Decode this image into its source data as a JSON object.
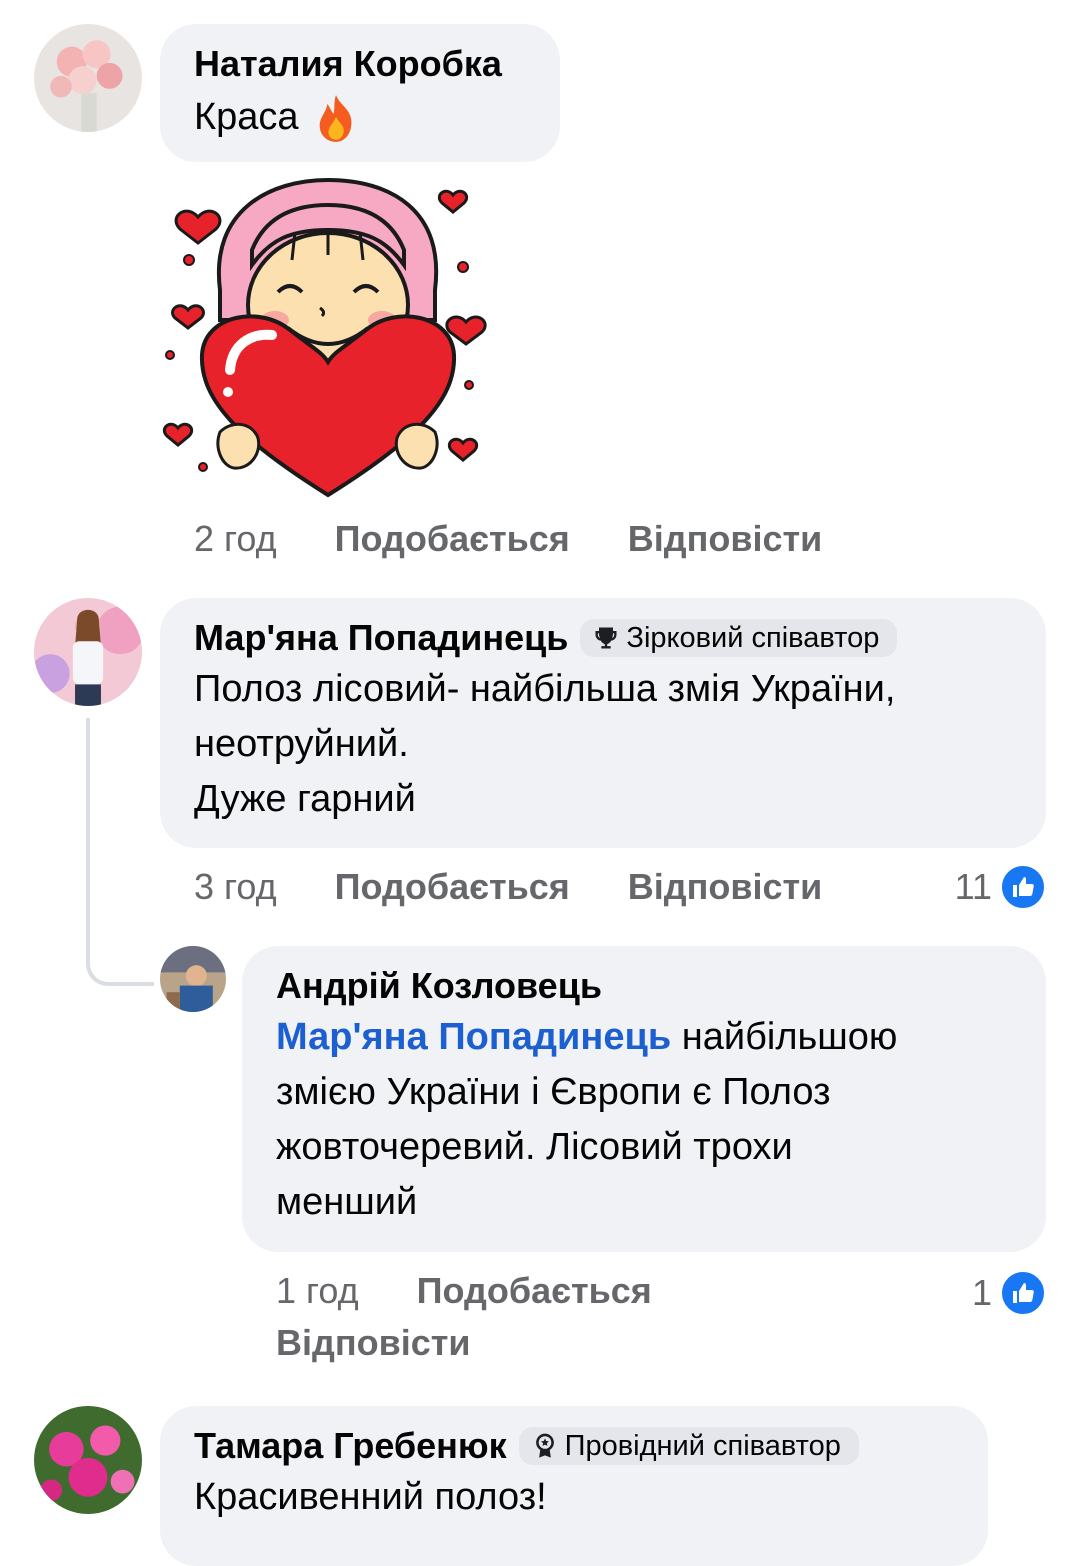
{
  "comments": [
    {
      "author": "Наталия Коробка",
      "text": "Краса",
      "emoji": "fire-emoji",
      "sticker": "heart-girl-sticker",
      "time": "2 год",
      "like_label": "Подобається",
      "reply_label": "Відповісти"
    },
    {
      "author": "Мар'яна Попадинець",
      "badge": "Зірковий співавтор",
      "badge_icon": "trophy-icon",
      "text_lines": [
        "Полоз лісовий- найбільша змія України,",
        "неотруйний.",
        "Дуже гарний"
      ],
      "time": "3 год",
      "like_label": "Подобається",
      "reply_label": "Відповісти",
      "reaction_count": "11",
      "reaction_icon": "like-icon",
      "replies": [
        {
          "author": "Андрій Козловець",
          "mention": "Мар'яна Попадинець",
          "text_first": "найбільшою",
          "text_lines": [
            "змією України і Європи є Полоз",
            "жовточеревий. Лісовий трохи",
            "менший"
          ],
          "time": "1 год",
          "like_label": "Подобається",
          "reply_label": "Відповісти",
          "reaction_count": "1",
          "reaction_icon": "like-icon"
        }
      ]
    },
    {
      "author": "Тамара Гребенюк",
      "badge": "Провідний співавтор",
      "badge_icon": "medal-icon",
      "text": "Красивенний полоз!"
    }
  ],
  "colors": {
    "bubble": "#f0f2f5",
    "meta": "#65676b",
    "mention": "#1b5fd1",
    "like": "#1877f2"
  }
}
